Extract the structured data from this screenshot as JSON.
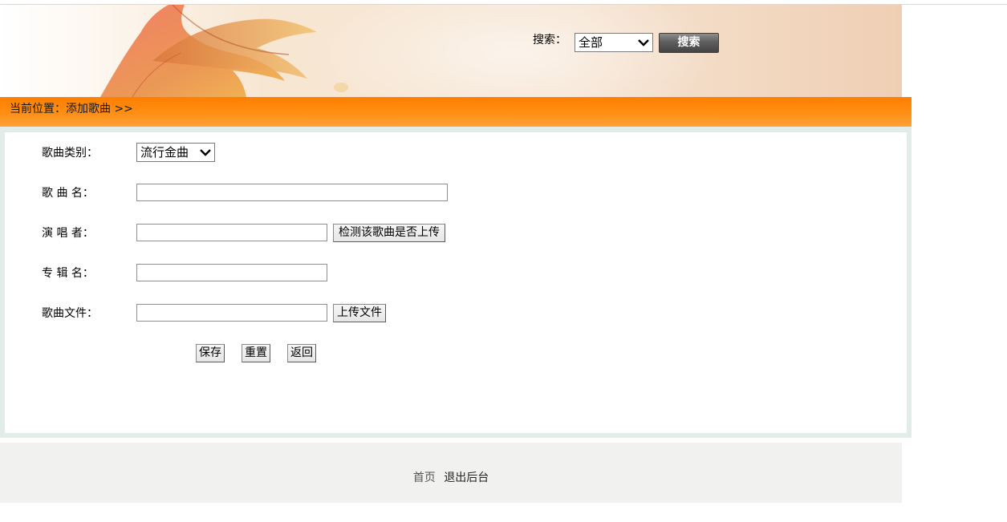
{
  "header": {
    "search_label": "搜索：",
    "search_scope": "全部",
    "search_button": "搜索"
  },
  "location": {
    "text": "当前位置：添加歌曲 >>"
  },
  "form": {
    "category_label": "歌曲类别：",
    "category_value": "流行金曲",
    "song_name_label": "歌 曲 名：",
    "song_name_value": "",
    "singer_label": "演 唱 者：",
    "singer_value": "",
    "check_button": "检测该歌曲是否上传",
    "album_label": "专 辑 名：",
    "album_value": "",
    "file_label": "歌曲文件：",
    "file_value": "",
    "upload_button": "上传文件",
    "save_button": "保存",
    "reset_button": "重置",
    "back_button": "返回"
  },
  "footer": {
    "home_link": "首页",
    "logout_link": "退出后台"
  },
  "colors": {
    "orange_bar": "#ff8a10",
    "panel_border": "#e2ece9",
    "footer_bg": "#f1f1ef"
  }
}
